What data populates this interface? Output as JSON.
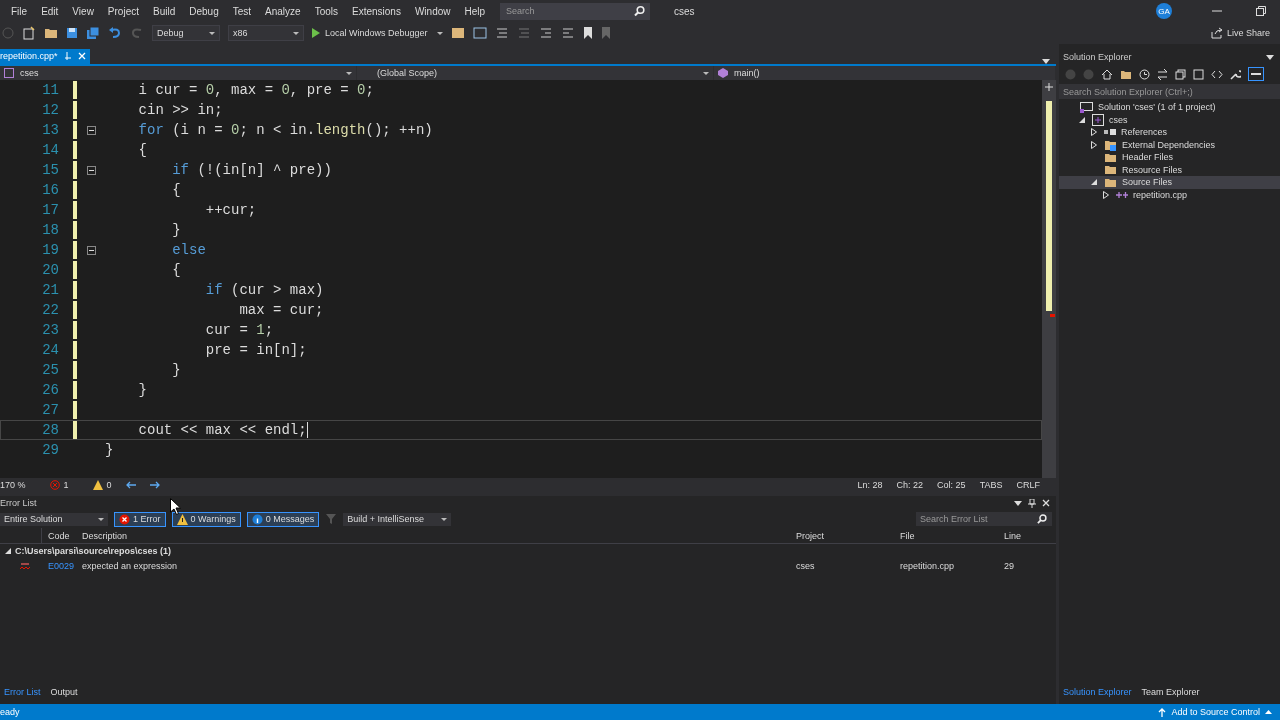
{
  "menu": [
    "File",
    "Edit",
    "View",
    "Project",
    "Build",
    "Debug",
    "Test",
    "Analyze",
    "Tools",
    "Extensions",
    "Window",
    "Help"
  ],
  "search": {
    "placeholder": "Search"
  },
  "solution_name": "cses",
  "account": {
    "initials": "GA"
  },
  "toolbar": {
    "configuration": "Debug",
    "platform": "x86",
    "debugger": "Local Windows Debugger",
    "live_share": "Live Share"
  },
  "editor_tabs": [
    {
      "label": "repetition.cpp*",
      "selected": true
    }
  ],
  "navigation": {
    "project": "cses",
    "scope": "(Global Scope)",
    "member": "main()"
  },
  "code": [
    {
      "number": "11",
      "changed": true,
      "fold": false,
      "current": false,
      "tokens": [
        {
          "t": "    i cur = ",
          "kind": "plain"
        },
        {
          "t": "0",
          "kind": "num"
        },
        {
          "t": ", max = ",
          "kind": "plain"
        },
        {
          "t": "0",
          "kind": "num"
        },
        {
          "t": ", pre = ",
          "kind": "plain"
        },
        {
          "t": "0",
          "kind": "num"
        },
        {
          "t": ";",
          "kind": "plain"
        }
      ]
    },
    {
      "number": "12",
      "changed": true,
      "fold": false,
      "current": false,
      "tokens": [
        {
          "t": "    cin >> in;",
          "kind": "plain"
        }
      ]
    },
    {
      "number": "13",
      "changed": true,
      "fold": true,
      "current": false,
      "tokens": [
        {
          "t": "    for",
          "kind": "kw"
        },
        {
          "t": " (i n = ",
          "kind": "plain"
        },
        {
          "t": "0",
          "kind": "num"
        },
        {
          "t": "; n < in.",
          "kind": "plain"
        },
        {
          "t": "length",
          "kind": "fn"
        },
        {
          "t": "(); ++n)",
          "kind": "plain"
        }
      ]
    },
    {
      "number": "14",
      "changed": true,
      "fold": false,
      "current": false,
      "tokens": [
        {
          "t": "    {",
          "kind": "plain"
        }
      ]
    },
    {
      "number": "15",
      "changed": true,
      "fold": true,
      "current": false,
      "tokens": [
        {
          "t": "        if",
          "kind": "kw"
        },
        {
          "t": " (!(in[n] ^ pre))",
          "kind": "plain"
        }
      ]
    },
    {
      "number": "16",
      "changed": true,
      "fold": false,
      "current": false,
      "tokens": [
        {
          "t": "        {",
          "kind": "plain"
        }
      ]
    },
    {
      "number": "17",
      "changed": true,
      "fold": false,
      "current": false,
      "tokens": [
        {
          "t": "            ++cur;",
          "kind": "plain"
        }
      ]
    },
    {
      "number": "18",
      "changed": true,
      "fold": false,
      "current": false,
      "tokens": [
        {
          "t": "        }",
          "kind": "plain"
        }
      ]
    },
    {
      "number": "19",
      "changed": true,
      "fold": true,
      "current": false,
      "tokens": [
        {
          "t": "        else",
          "kind": "kw"
        }
      ]
    },
    {
      "number": "20",
      "changed": true,
      "fold": false,
      "current": false,
      "tokens": [
        {
          "t": "        {",
          "kind": "plain"
        }
      ]
    },
    {
      "number": "21",
      "changed": true,
      "fold": false,
      "current": false,
      "tokens": [
        {
          "t": "            if",
          "kind": "kw"
        },
        {
          "t": " (cur > max)",
          "kind": "plain"
        }
      ]
    },
    {
      "number": "22",
      "changed": true,
      "fold": false,
      "current": false,
      "tokens": [
        {
          "t": "                max = cur;",
          "kind": "plain"
        }
      ]
    },
    {
      "number": "23",
      "changed": true,
      "fold": false,
      "current": false,
      "tokens": [
        {
          "t": "            cur = ",
          "kind": "plain"
        },
        {
          "t": "1",
          "kind": "num"
        },
        {
          "t": ";",
          "kind": "plain"
        }
      ]
    },
    {
      "number": "24",
      "changed": true,
      "fold": false,
      "current": false,
      "tokens": [
        {
          "t": "            pre = in[n];",
          "kind": "plain"
        }
      ]
    },
    {
      "number": "25",
      "changed": true,
      "fold": false,
      "current": false,
      "tokens": [
        {
          "t": "        }",
          "kind": "plain"
        }
      ]
    },
    {
      "number": "26",
      "changed": true,
      "fold": false,
      "current": false,
      "tokens": [
        {
          "t": "    }",
          "kind": "plain"
        }
      ]
    },
    {
      "number": "27",
      "changed": true,
      "fold": false,
      "current": false
    },
    {
      "number": "28",
      "changed": true,
      "fold": false,
      "current": true,
      "tokens": [
        {
          "t": "    cout << max << endl;",
          "kind": "plain"
        }
      ]
    },
    {
      "number": "29",
      "changed": false,
      "fold": false,
      "current": false,
      "tokens": [
        {
          "t": "}",
          "kind": "plain"
        }
      ]
    }
  ],
  "editor_status": {
    "zoom": "170 %",
    "errors": "1",
    "warnings": "0",
    "line": "Ln: 28",
    "char": "Ch: 22",
    "column": "Col: 25",
    "indent": "TABS",
    "line_ending": "CRLF"
  },
  "error_list": {
    "title": "Error List",
    "scope": "Entire Solution",
    "filters": [
      {
        "label": "1 Error",
        "kind": "error",
        "selected": true
      },
      {
        "label": "0 Warnings",
        "kind": "warning",
        "selected": true
      },
      {
        "label": "0 Messages",
        "kind": "info",
        "selected": true
      }
    ],
    "source": "Build + IntelliSense",
    "search": {
      "placeholder": "Search Error List"
    },
    "columns": [
      "Code",
      "Description",
      "Project",
      "File",
      "Line"
    ],
    "groups": [
      {
        "label": "C:\\Users\\parsi\\source\\repos\\cses (1)",
        "expanded": true,
        "rows": [
          {
            "code": "E0029",
            "description": "expected an expression",
            "project": "cses",
            "file": "repetition.cpp",
            "line": "29"
          }
        ]
      }
    ]
  },
  "bottom_tabs": [
    {
      "label": "Error List",
      "selected": true
    },
    {
      "label": "Output",
      "selected": false
    }
  ],
  "solution_explorer": {
    "title": "Solution Explorer",
    "search": {
      "placeholder": "Search Solution Explorer (Ctrl+;)"
    },
    "tree": [
      {
        "label": "Solution 'cses' (1 of 1 project)",
        "kind": "solution",
        "selected": false,
        "children": [
          {
            "label": "cses",
            "kind": "project",
            "expanded": true,
            "selected": false,
            "children": [
              {
                "label": "References",
                "kind": "references",
                "expanded": false,
                "selected": false
              },
              {
                "label": "External Dependencies",
                "kind": "external",
                "expanded": false,
                "selected": false
              },
              {
                "label": "Header Files",
                "kind": "folder",
                "selected": false
              },
              {
                "label": "Resource Files",
                "kind": "folder",
                "selected": false
              },
              {
                "label": "Source Files",
                "kind": "folder",
                "expanded": true,
                "selected": true,
                "children": [
                  {
                    "label": "repetition.cpp",
                    "kind": "cpp",
                    "expanded": false,
                    "selected": false
                  }
                ]
              }
            ]
          }
        ]
      }
    ]
  },
  "side_tabs": [
    {
      "label": "Solution Explorer",
      "selected": true
    },
    {
      "label": "Team Explorer",
      "selected": false
    }
  ],
  "status_bar": {
    "message": "eady",
    "source_control": "Add to Source Control"
  }
}
